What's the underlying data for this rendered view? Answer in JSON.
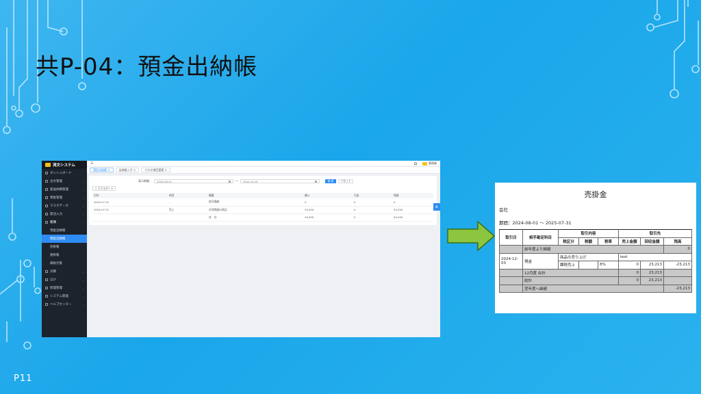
{
  "slide": {
    "title": "共P-04：預金出納帳",
    "page_number": "P11"
  },
  "app": {
    "brand": "流文システム",
    "topbar": {
      "username": "管理者"
    },
    "sidebar": {
      "items": [
        {
          "label": "ダッシュボード"
        },
        {
          "label": "注文管理"
        },
        {
          "label": "発送依頼管理"
        },
        {
          "label": "預金管理"
        },
        {
          "label": "マスタデータ"
        },
        {
          "label": "発注入力"
        },
        {
          "label": "帳簿"
        },
        {
          "label": "現金出納帳"
        },
        {
          "label": "預金出納帳"
        },
        {
          "label": "売掛帳"
        },
        {
          "label": "買掛帳"
        },
        {
          "label": "補助元帳"
        },
        {
          "label": "決算"
        },
        {
          "label": "ほか"
        },
        {
          "label": "経理管理"
        },
        {
          "label": "システム管理"
        },
        {
          "label": "ヘルプセンター"
        }
      ]
    },
    "tabs": [
      {
        "label": "預金出納帳 ×"
      },
      {
        "label": "出納帳入力 ×"
      },
      {
        "label": "マスタ項目管理 ×"
      }
    ],
    "filter": {
      "label": "表示期間：",
      "date_from": "2024-08-01",
      "separator": "～",
      "date_to": "2024-12-31",
      "search_label": "検 索",
      "reset_label": "リセット"
    },
    "export_label": "エクスポート",
    "table": {
      "columns": [
        "日付",
        "科目",
        "摘要",
        "預入",
        "引出",
        "残高"
      ],
      "rows": [
        [
          "2024-07-31",
          "-",
          "前月繰越",
          "0",
          "0",
          "0"
        ],
        [
          "2024-07-31",
          "売上",
          "台湾問屋の商品",
          "34,000",
          "0",
          "34,000"
        ],
        [
          "",
          "",
          "合　計",
          "34,000",
          "0",
          "34,000"
        ]
      ]
    }
  },
  "report": {
    "title": "売掛金",
    "company": "会社",
    "period": "期間：2024-08-01 ～ 2025-07-31",
    "headers": {
      "date": "取引日",
      "account": "相手勘定科目",
      "content": "取引内容",
      "tax_class": "税区分",
      "tax_amount": "税額",
      "tax_rate": "税率",
      "partner": "取引先",
      "sales": "売上金額",
      "collected": "回収金額",
      "balance": "残高"
    },
    "rows": {
      "carry_in_label": "前年度より繰越",
      "carry_in_balance": "0",
      "tx_date": "2024-12-03",
      "tx_account": "現金",
      "tx_content": "商品の売り上げ",
      "tx_partner": "test",
      "tx_tax_class": "課税売上",
      "tx_tax_rate": "8%",
      "tx_sales": "0",
      "tx_collected": "23,213",
      "tx_balance": "-23,213",
      "month_total_label": "12月度 合計",
      "month_total_sales": "0",
      "month_total_collected": "23,213",
      "total_label": "総計",
      "total_sales": "0",
      "total_collected": "23,213",
      "carry_out_label": "翌年度へ繰越",
      "carry_out_balance": "-23,213"
    }
  }
}
